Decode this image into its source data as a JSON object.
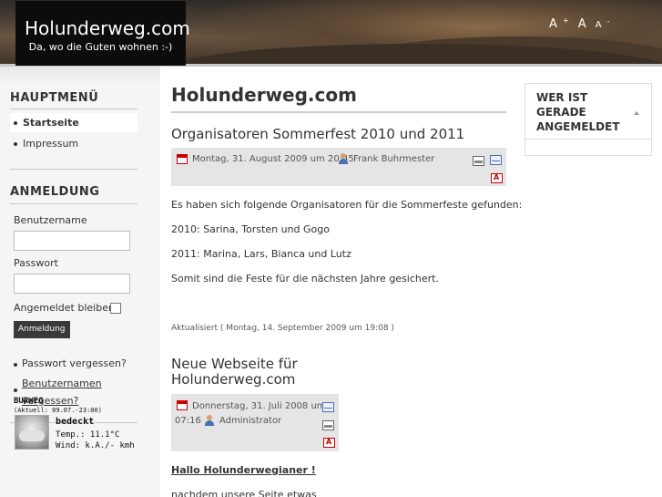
{
  "header": {
    "site_title": "Holunderweg.com",
    "tagline": "Da, wo die Guten wohnen :-)",
    "font_tools": {
      "larger": "A",
      "larger_sup": "+",
      "reset": "A",
      "smaller": "A",
      "smaller_sup": "-"
    }
  },
  "main_menu": {
    "title": "HAUPTMENÜ",
    "items": [
      {
        "label": "Startseite",
        "active": true
      },
      {
        "label": "Impressum",
        "active": false
      }
    ]
  },
  "login": {
    "title": "ANMELDUNG",
    "username_label": "Benutzername",
    "username_value": "",
    "password_label": "Passwort",
    "password_value": "",
    "remember_label": "Angemeldet bleiben",
    "remember_checked": false,
    "submit_label": "Anmeldung",
    "forgot_password": "Passwort vergessen?",
    "forgot_username": "Benutzernamen vergessen?"
  },
  "weather": {
    "place": "BURWEG",
    "updated": "(Aktuell: 09.07.-23:00)",
    "condition": "bedeckt",
    "temperature": "Temp.: 11.1°C",
    "wind": "Wind: k.A./- kmh"
  },
  "main": {
    "page_title": "Holunderweg.com",
    "articles": [
      {
        "title": "Organisatoren Sommerfest 2010 und 2011",
        "date": "Montag, 31. August 2009 um 20:45",
        "author": "Frank Buhrmester",
        "paragraphs": [
          "Es haben sich folgende Organisatoren für die Sommerfeste gefunden:",
          "2010: Sarina, Torsten und Gogo",
          "2011: Marina, Lars, Bianca und Lutz",
          "Somit sind die Feste für die nächsten Jahre gesichert."
        ],
        "updated": "Aktualisiert ( Montag, 14. September 2009 um 19:08 )"
      },
      {
        "title_line1": "Neue Webseite für",
        "title_line2": "Holunderweg.com",
        "date_line1": "Donnerstag, 31. Juli 2008 um",
        "date_line2": "07:16",
        "author": "Administrator",
        "greeting": "Hallo Holunderwegianer !",
        "snippet": "nachdem unsere Seite etwas"
      }
    ]
  },
  "right": {
    "who_online_title": "WER IST GERADE ANGEMELDET"
  },
  "icons": [
    "calendar-icon",
    "user-icon",
    "print-icon",
    "email-icon",
    "pdf-icon",
    "weather-cloud-icon"
  ],
  "colors": {
    "header_bg": "#0c0c0c",
    "sidebar_bg": "#f5f5f5",
    "meta_bg": "#e5e5e5",
    "button_bg": "#3a3a3a"
  }
}
